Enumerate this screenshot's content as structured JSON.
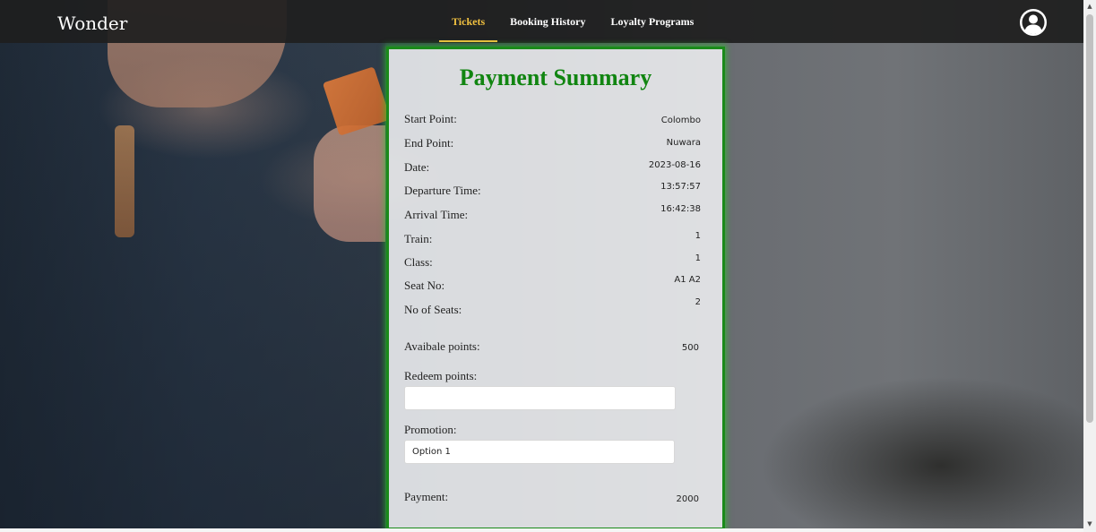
{
  "header": {
    "brand": "Wonder",
    "nav": [
      {
        "label": "Tickets",
        "active": true
      },
      {
        "label": "Booking History",
        "active": false
      },
      {
        "label": "Loyalty Programs",
        "active": false
      }
    ],
    "profile_icon": "user-circle-icon"
  },
  "summary": {
    "title": "Payment Summary",
    "rows": [
      {
        "label": "Start Point:",
        "value": "Colombo"
      },
      {
        "label": "End Point:",
        "value": "Nuwara"
      },
      {
        "label": "Date:",
        "value": "2023-08-16"
      },
      {
        "label": "Departure Time:",
        "value": "13:57:57"
      },
      {
        "label": "Arrival Time:",
        "value": "16:42:38"
      },
      {
        "label": "Train:",
        "value": "1"
      },
      {
        "label": "Class:",
        "value": "1"
      },
      {
        "label": "Seat No:",
        "value": "A1 A2"
      },
      {
        "label": "No of Seats:",
        "value": "2"
      }
    ],
    "available_points_label": "Avaibale points:",
    "available_points_value": "500",
    "redeem_label": "Redeem points:",
    "redeem_value": "",
    "promotion_label": "Promotion:",
    "promotion_value": "Option 1",
    "payment_label": "Payment:",
    "payment_value": "2000"
  },
  "colors": {
    "accent": "#f0c040",
    "title_green": "#118511",
    "border_green": "#1a8a1a"
  }
}
